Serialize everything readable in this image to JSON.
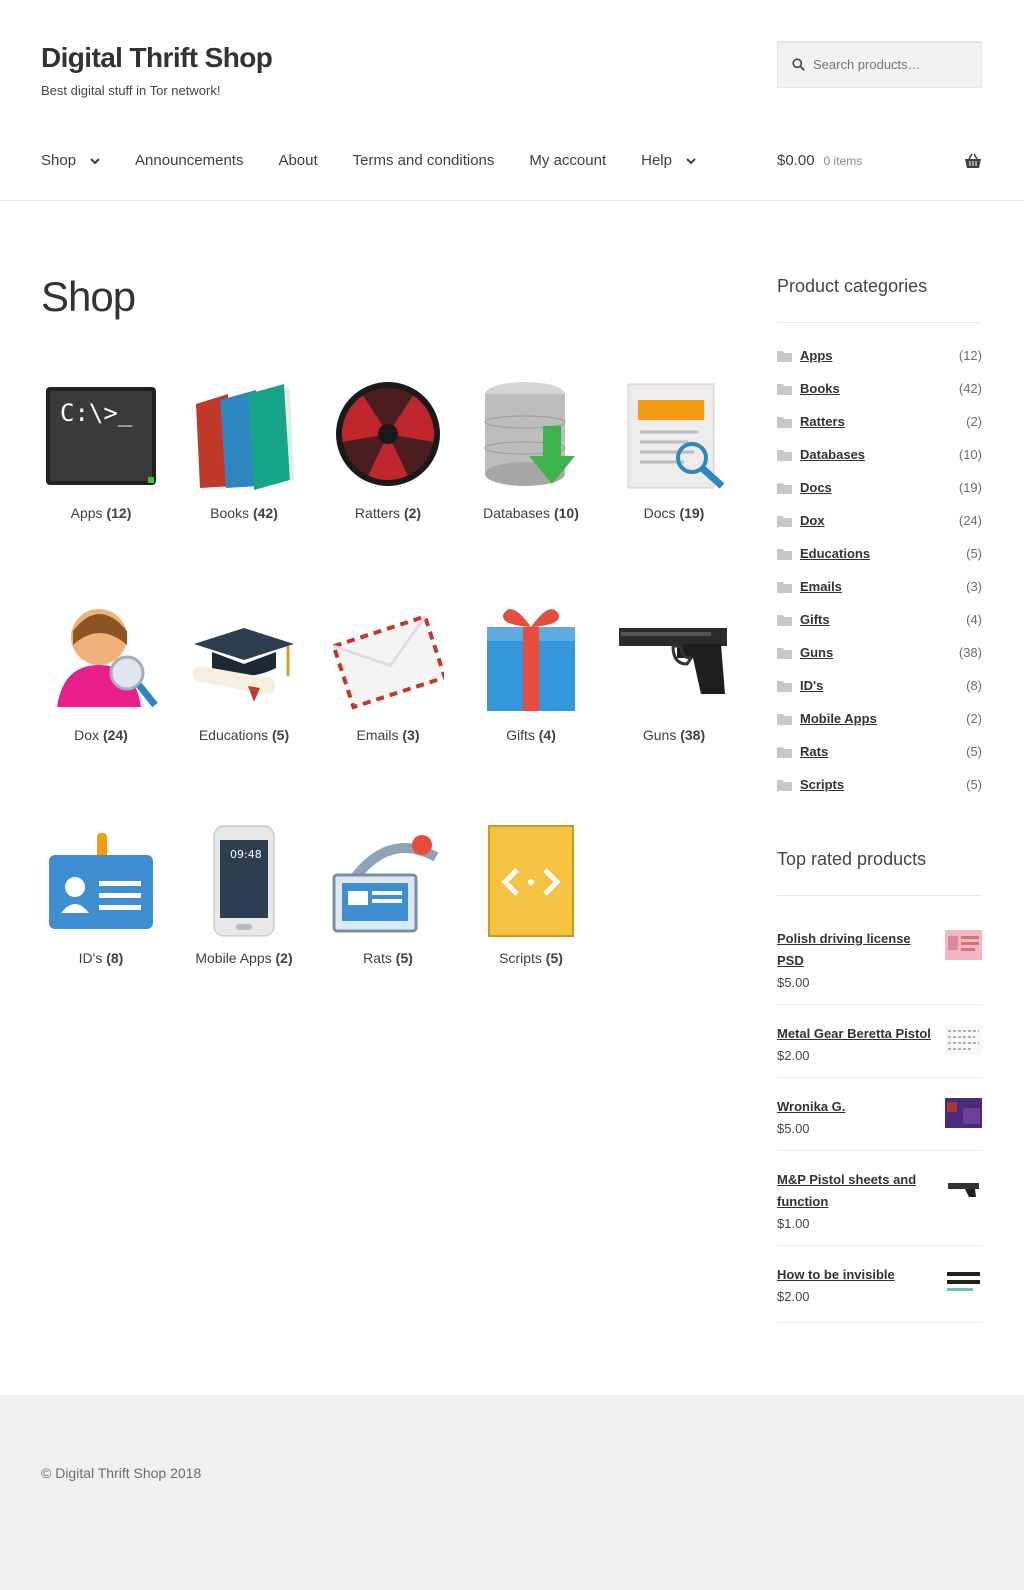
{
  "site": {
    "title": "Digital Thrift Shop",
    "tagline": "Best digital stuff in Tor network!"
  },
  "search": {
    "placeholder": "Search products…"
  },
  "nav": {
    "items": [
      {
        "label": "Shop",
        "has_dropdown": true
      },
      {
        "label": "Announcements",
        "has_dropdown": false
      },
      {
        "label": "About",
        "has_dropdown": false
      },
      {
        "label": "Terms and conditions",
        "has_dropdown": false
      },
      {
        "label": "My account",
        "has_dropdown": false
      },
      {
        "label": "Help",
        "has_dropdown": true
      }
    ]
  },
  "cart": {
    "amount": "$0.00",
    "items": "0 items",
    "icon": "basket-icon"
  },
  "page": {
    "title": "Shop"
  },
  "categories": [
    {
      "name": "Apps",
      "count": "(12)",
      "icon": "terminal-icon"
    },
    {
      "name": "Books",
      "count": "(42)",
      "icon": "books-icon"
    },
    {
      "name": "Ratters",
      "count": "(2)",
      "icon": "radiation-icon"
    },
    {
      "name": "Databases",
      "count": "(10)",
      "icon": "database-download-icon"
    },
    {
      "name": "Docs",
      "count": "(19)",
      "icon": "document-search-icon"
    },
    {
      "name": "Dox",
      "count": "(24)",
      "icon": "person-search-icon"
    },
    {
      "name": "Educations",
      "count": "(5)",
      "icon": "graduation-cap-icon"
    },
    {
      "name": "Emails",
      "count": "(3)",
      "icon": "envelope-icon"
    },
    {
      "name": "Gifts",
      "count": "(4)",
      "icon": "gift-icon"
    },
    {
      "name": "Guns",
      "count": "(38)",
      "icon": "pistol-icon"
    },
    {
      "name": "ID's",
      "count": "(8)",
      "icon": "id-card-icon"
    },
    {
      "name": "Mobile Apps",
      "count": "(2)",
      "icon": "smartphone-icon"
    },
    {
      "name": "Rats",
      "count": "(5)",
      "icon": "remote-desktop-icon"
    },
    {
      "name": "Scripts",
      "count": "(5)",
      "icon": "code-file-icon"
    }
  ],
  "sidebar": {
    "categories_title": "Product categories",
    "categories": [
      {
        "name": "Apps",
        "count": "(12)"
      },
      {
        "name": "Books",
        "count": "(42)"
      },
      {
        "name": "Ratters",
        "count": "(2)"
      },
      {
        "name": "Databases",
        "count": "(10)"
      },
      {
        "name": "Docs",
        "count": "(19)"
      },
      {
        "name": "Dox",
        "count": "(24)"
      },
      {
        "name": "Educations",
        "count": "(5)"
      },
      {
        "name": "Emails",
        "count": "(3)"
      },
      {
        "name": "Gifts",
        "count": "(4)"
      },
      {
        "name": "Guns",
        "count": "(38)"
      },
      {
        "name": "ID's",
        "count": "(8)"
      },
      {
        "name": "Mobile Apps",
        "count": "(2)"
      },
      {
        "name": "Rats",
        "count": "(5)"
      },
      {
        "name": "Scripts",
        "count": "(5)"
      }
    ],
    "top_rated_title": "Top rated products",
    "top_rated": [
      {
        "name": "Polish driving license PSD",
        "price": "$5.00"
      },
      {
        "name": "Metal Gear Beretta Pistol",
        "price": "$2.00"
      },
      {
        "name": "Wronika G.",
        "price": "$5.00"
      },
      {
        "name": "M&P Pistol sheets and function",
        "price": "$1.00"
      },
      {
        "name": "How to be invisible",
        "price": "$2.00"
      }
    ]
  },
  "footer": {
    "copyright": "© Digital Thrift Shop 2018"
  },
  "colors": {
    "link": "#333333",
    "text": "#43454b",
    "footer_bg": "#f0f0f0"
  }
}
